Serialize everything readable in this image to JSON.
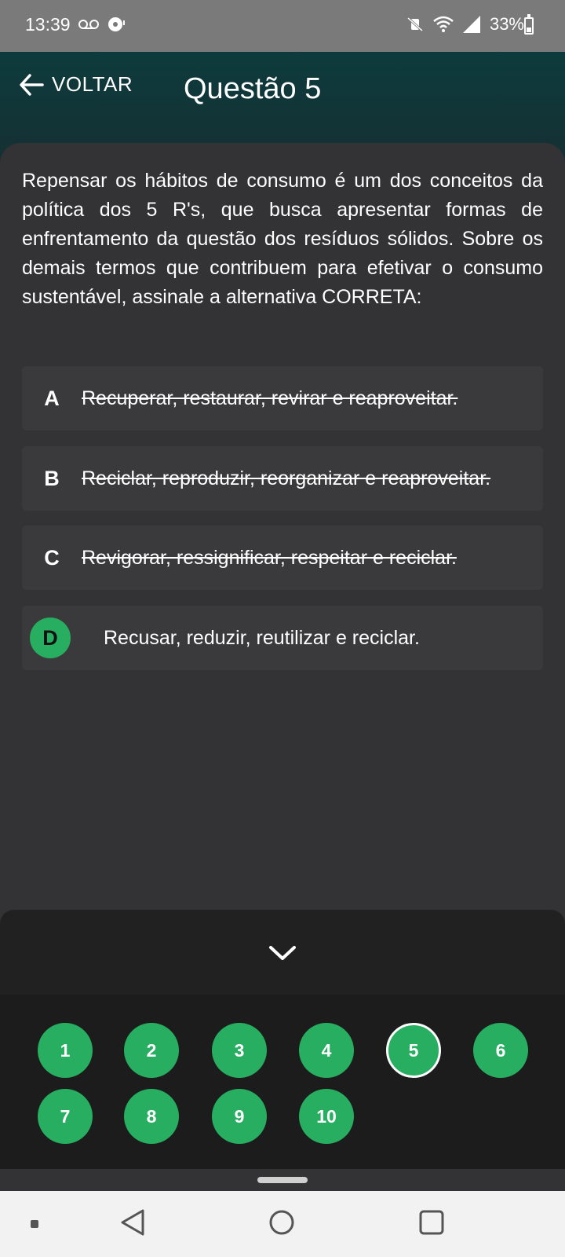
{
  "status": {
    "time": "13:39",
    "battery": "33%"
  },
  "header": {
    "back_label": "VOLTAR",
    "title": "Questão 5"
  },
  "question": {
    "text": "Repensar os hábitos de consumo é um dos conceitos da política dos 5 R's, que busca apresentar formas de enfrentamento da questão dos resíduos sólidos. Sobre os demais termos que contribuem para efetivar o consumo sustentável, assinale a alternativa CORRETA:"
  },
  "options": [
    {
      "letter": "A",
      "text": "Recuperar, restaurar, revirar e reaproveitar.",
      "state": "eliminated"
    },
    {
      "letter": "B",
      "text": "Reciclar, reproduzir, reorganizar e reaproveitar.",
      "state": "eliminated"
    },
    {
      "letter": "C",
      "text": "Revigorar, ressignificar, respeitar e reciclar.",
      "state": "eliminated"
    },
    {
      "letter": "D",
      "text": "Recusar, reduzir, reutilizar e reciclar.",
      "state": "selected"
    }
  ],
  "navigator": {
    "current": "5",
    "numbers": [
      "1",
      "2",
      "3",
      "4",
      "5",
      "6",
      "7",
      "8",
      "9",
      "10"
    ]
  },
  "colors": {
    "accent": "#27ae60",
    "header": "#0d3b3d",
    "background": "#333234"
  }
}
